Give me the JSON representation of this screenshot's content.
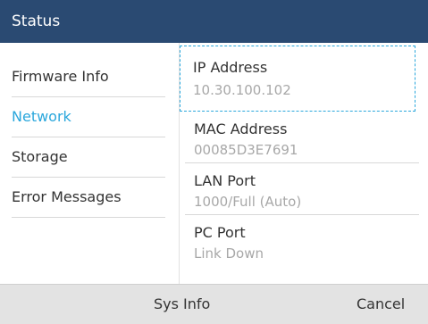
{
  "header": {
    "title": "Status"
  },
  "sidebar": {
    "items": [
      {
        "label": "Firmware Info",
        "active": false
      },
      {
        "label": "Network",
        "active": true
      },
      {
        "label": "Storage",
        "active": false
      },
      {
        "label": "Error Messages",
        "active": false
      }
    ]
  },
  "details": {
    "fields": [
      {
        "label": "IP Address",
        "value": "10.30.100.102"
      },
      {
        "label": "MAC Address",
        "value": "00085D3E7691"
      },
      {
        "label": "LAN Port",
        "value": "1000/Full (Auto)"
      },
      {
        "label": "PC Port",
        "value": "Link Down"
      }
    ]
  },
  "softkeys": {
    "sys_info": "Sys Info",
    "cancel": "Cancel"
  },
  "colors": {
    "title_bar": "#2a4a72",
    "accent": "#2aa7dc",
    "footer": "#e3e3e3"
  }
}
